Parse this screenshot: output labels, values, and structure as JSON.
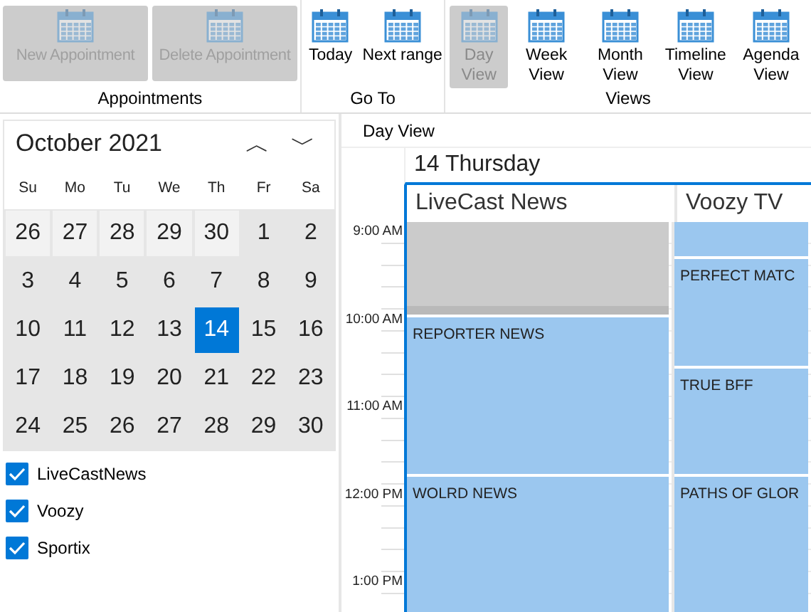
{
  "ribbon": {
    "groups": [
      {
        "label": "Appointments",
        "buttons": [
          {
            "label": "New Appointment",
            "disabled": true,
            "selected": false
          },
          {
            "label": "Delete Appointment",
            "disabled": true,
            "selected": false
          }
        ]
      },
      {
        "label": "Go To",
        "buttons": [
          {
            "label": "Today",
            "disabled": false,
            "selected": false
          },
          {
            "label": "Next range",
            "disabled": false,
            "selected": false
          }
        ]
      },
      {
        "label": "Views",
        "buttons": [
          {
            "label": "Day View",
            "disabled": false,
            "selected": true
          },
          {
            "label": "Week View",
            "disabled": false,
            "selected": false
          },
          {
            "label": "Month View",
            "disabled": false,
            "selected": false
          },
          {
            "label": "Timeline View",
            "disabled": false,
            "selected": false
          },
          {
            "label": "Agenda View",
            "disabled": false,
            "selected": false
          }
        ]
      }
    ]
  },
  "calendar": {
    "title": "October 2021",
    "prev": "︿",
    "next": "﹀",
    "weekdays": [
      "Su",
      "Mo",
      "Tu",
      "We",
      "Th",
      "Fr",
      "Sa"
    ],
    "days": [
      {
        "label": "26",
        "other_month": true,
        "selected": false
      },
      {
        "label": "27",
        "other_month": true,
        "selected": false
      },
      {
        "label": "28",
        "other_month": true,
        "selected": false
      },
      {
        "label": "29",
        "other_month": true,
        "selected": false
      },
      {
        "label": "30",
        "other_month": true,
        "selected": false
      },
      {
        "label": "1",
        "other_month": false,
        "selected": false
      },
      {
        "label": "2",
        "other_month": false,
        "selected": false
      },
      {
        "label": "3",
        "other_month": false,
        "selected": false
      },
      {
        "label": "4",
        "other_month": false,
        "selected": false
      },
      {
        "label": "5",
        "other_month": false,
        "selected": false
      },
      {
        "label": "6",
        "other_month": false,
        "selected": false
      },
      {
        "label": "7",
        "other_month": false,
        "selected": false
      },
      {
        "label": "8",
        "other_month": false,
        "selected": false
      },
      {
        "label": "9",
        "other_month": false,
        "selected": false
      },
      {
        "label": "10",
        "other_month": false,
        "selected": false
      },
      {
        "label": "11",
        "other_month": false,
        "selected": false
      },
      {
        "label": "12",
        "other_month": false,
        "selected": false
      },
      {
        "label": "13",
        "other_month": false,
        "selected": false
      },
      {
        "label": "14",
        "other_month": false,
        "selected": true
      },
      {
        "label": "15",
        "other_month": false,
        "selected": false
      },
      {
        "label": "16",
        "other_month": false,
        "selected": false
      },
      {
        "label": "17",
        "other_month": false,
        "selected": false
      },
      {
        "label": "18",
        "other_month": false,
        "selected": false
      },
      {
        "label": "19",
        "other_month": false,
        "selected": false
      },
      {
        "label": "20",
        "other_month": false,
        "selected": false
      },
      {
        "label": "21",
        "other_month": false,
        "selected": false
      },
      {
        "label": "22",
        "other_month": false,
        "selected": false
      },
      {
        "label": "23",
        "other_month": false,
        "selected": false
      },
      {
        "label": "24",
        "other_month": false,
        "selected": false
      },
      {
        "label": "25",
        "other_month": false,
        "selected": false
      },
      {
        "label": "26",
        "other_month": false,
        "selected": false
      },
      {
        "label": "27",
        "other_month": false,
        "selected": false
      },
      {
        "label": "28",
        "other_month": false,
        "selected": false
      },
      {
        "label": "29",
        "other_month": false,
        "selected": false
      },
      {
        "label": "30",
        "other_month": false,
        "selected": false
      }
    ]
  },
  "resources_filter": [
    {
      "label": "LiveCastNews",
      "checked": true
    },
    {
      "label": "Voozy",
      "checked": true
    },
    {
      "label": "Sportix",
      "checked": true
    }
  ],
  "scheduler": {
    "view_label": "Day View",
    "date_header": "14 Thursday",
    "hours": [
      "9:00 AM",
      "10:00 AM",
      "11:00 AM",
      "12:00 PM",
      "1:00 PM"
    ],
    "resources": [
      {
        "name": "LiveCast News",
        "appointments": [
          {
            "kind": "blocked"
          },
          {
            "kind": "appointment",
            "subject": "REPORTER NEWS"
          },
          {
            "kind": "appointment",
            "subject": "WOLRD NEWS"
          }
        ]
      },
      {
        "name": "Voozy TV",
        "appointments": [
          {
            "kind": "appointment"
          },
          {
            "kind": "appointment",
            "subject": "PERFECT MATC"
          },
          {
            "kind": "appointment",
            "subject": "TRUE BFF"
          },
          {
            "kind": "appointment",
            "subject": "PATHS OF GLOR"
          }
        ]
      }
    ]
  }
}
